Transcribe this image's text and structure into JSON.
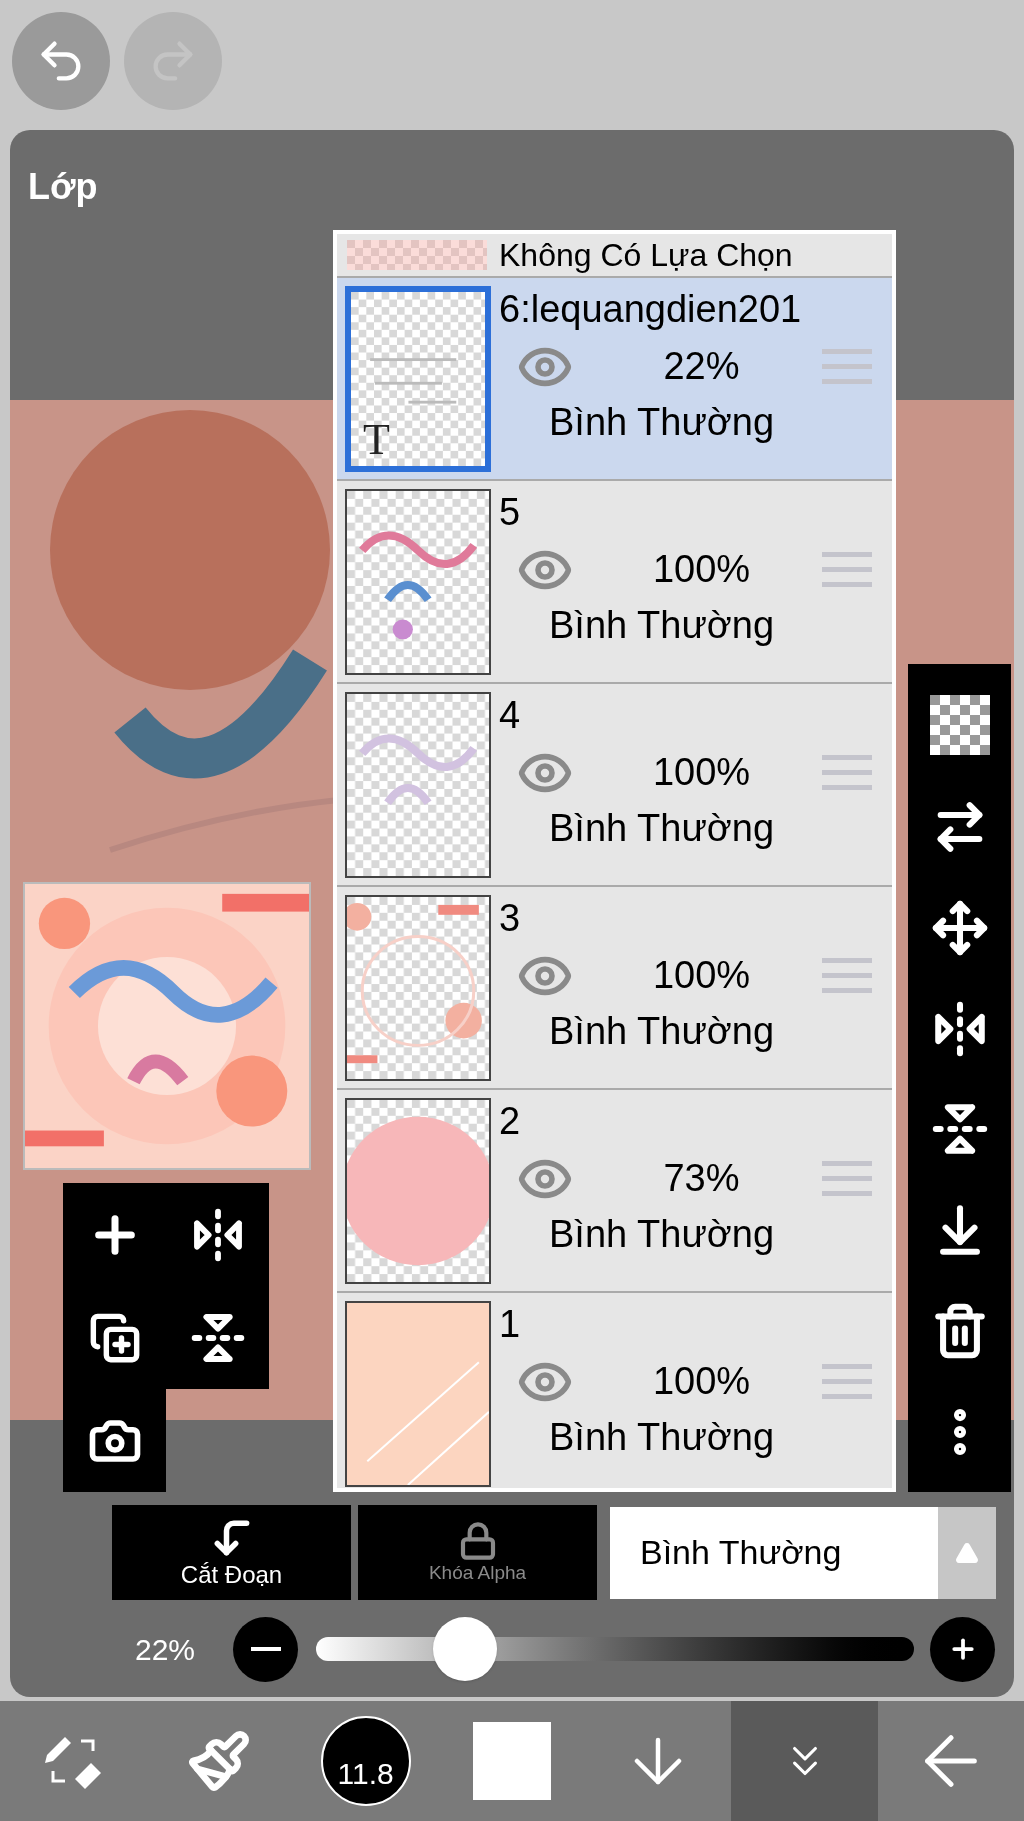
{
  "undo": {
    "disabled": false
  },
  "redo": {
    "disabled": true
  },
  "panel_title": "Lớp",
  "selection_layer": {
    "label": "Không Có Lựa Chọn"
  },
  "layers": [
    {
      "name": "6:lequangdien201",
      "opacity": "22%",
      "blend": "Bình Thường",
      "visible": true,
      "selected": true,
      "type_mark": "T",
      "kind": "text"
    },
    {
      "name": "5",
      "opacity": "100%",
      "blend": "Bình Thường",
      "visible": true,
      "selected": false,
      "kind": "lettering"
    },
    {
      "name": "4",
      "opacity": "100%",
      "blend": "Bình Thường",
      "visible": true,
      "selected": false,
      "kind": "faint"
    },
    {
      "name": "3",
      "opacity": "100%",
      "blend": "Bình Thường",
      "visible": true,
      "selected": false,
      "kind": "frame"
    },
    {
      "name": "2",
      "opacity": "73%",
      "blend": "Bình Thường",
      "visible": true,
      "selected": false,
      "kind": "circle"
    },
    {
      "name": "1",
      "opacity": "100%",
      "blend": "Bình Thường",
      "visible": true,
      "selected": false,
      "kind": "peach"
    }
  ],
  "clip_button": {
    "label": "Cắt Đoạn"
  },
  "alpha_lock": {
    "label": "Khóa Alpha",
    "on": false
  },
  "blend_select": {
    "value": "Bình Thường"
  },
  "opacity_slider": {
    "reading": "22%",
    "level": 0.22
  },
  "bottom_tools": [
    {
      "kind": "pen-eraser",
      "selected": false
    },
    {
      "kind": "brush",
      "selected": false
    },
    {
      "kind": "brush-size",
      "label": "11.8",
      "selected": false
    },
    {
      "kind": "color",
      "selected": false
    },
    {
      "kind": "arrow-down",
      "selected": false
    },
    {
      "kind": "chevrons",
      "selected": true
    },
    {
      "kind": "back",
      "selected": false
    }
  ]
}
